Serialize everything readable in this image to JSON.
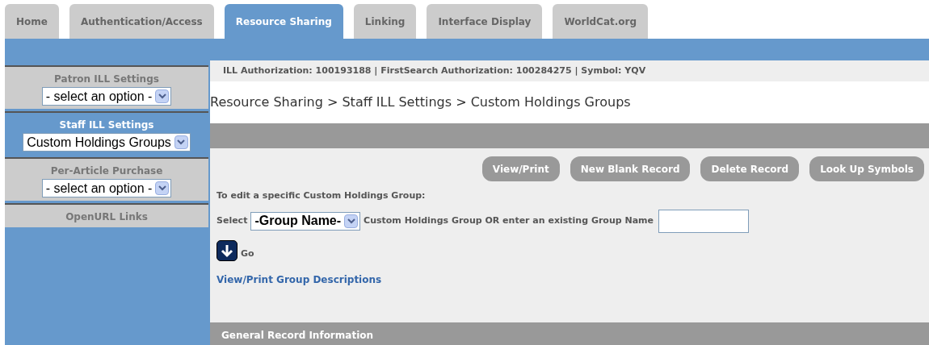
{
  "tabs": [
    {
      "label": "Home",
      "selected": false
    },
    {
      "label": "Authentication/Access",
      "selected": false
    },
    {
      "label": "Resource Sharing",
      "selected": true
    },
    {
      "label": "Linking",
      "selected": false
    },
    {
      "label": "Interface Display",
      "selected": false
    },
    {
      "label": "WorldCat.org",
      "selected": false
    }
  ],
  "sidebar": {
    "items": [
      {
        "title": "Patron ILL Settings",
        "selected": false,
        "select": "- select an option -"
      },
      {
        "title": "Staff ILL Settings",
        "selected": true,
        "select": "Custom Holdings Groups"
      },
      {
        "title": "Per-Article Purchase",
        "selected": false,
        "select": "- select an option -"
      },
      {
        "title": "OpenURL Links",
        "selected": false
      }
    ]
  },
  "info_line": "ILL Authorization: **100193188** | FirstSearch Authorization: **100284275** | Symbol: **YQV**",
  "breadcrumb": "Resource Sharing > Staff ILL Settings > Custom Holdings Groups",
  "buttons": [
    "View/Print",
    "New Blank Record",
    "Delete Record",
    "Look Up Symbols"
  ],
  "edit_prompt": "To edit a specific Custom Holdings Group:",
  "select_label": "Select",
  "group_select": "-Group Name-",
  "group_text": "Custom Holdings Group OR enter an existing Group Name",
  "go_label": "Go",
  "descriptions_link": "View/Print Group Descriptions",
  "section_header": "General Record Information"
}
